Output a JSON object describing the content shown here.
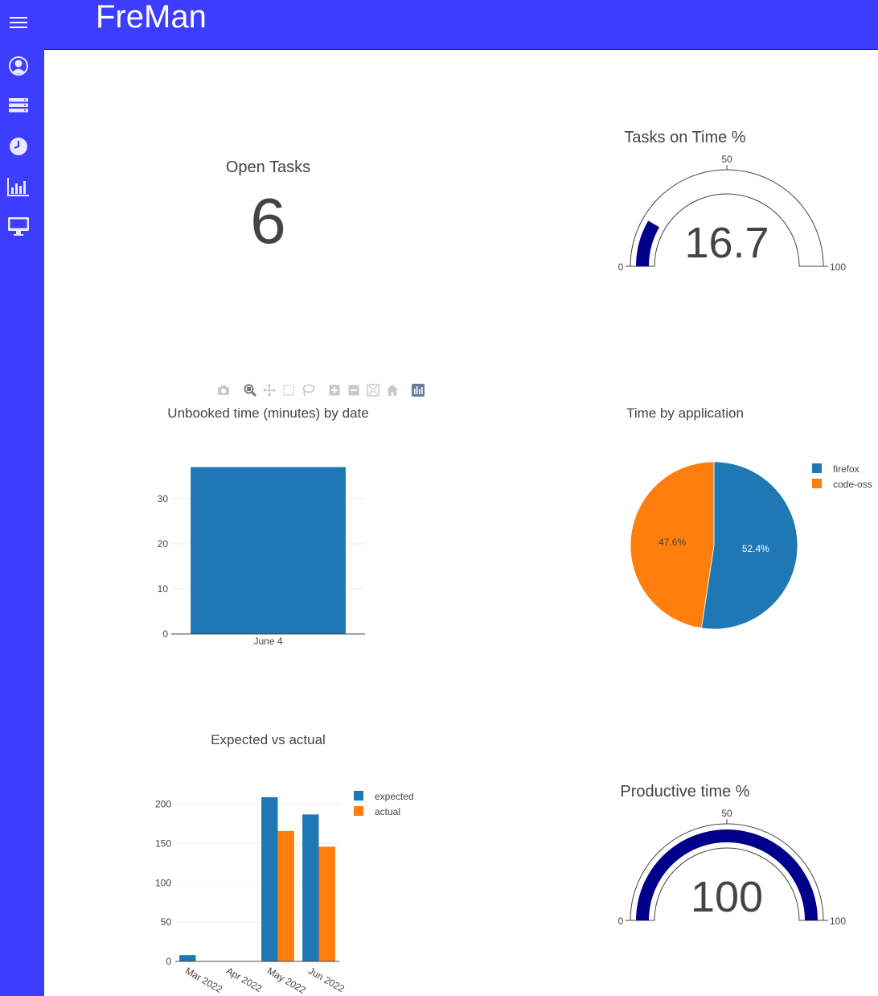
{
  "app": {
    "title": "FreMan"
  },
  "sidebar": {
    "items": [
      {
        "icon": "hamburger-menu-icon"
      },
      {
        "icon": "user-circle-icon"
      },
      {
        "icon": "server-icon"
      },
      {
        "icon": "clock-icon"
      },
      {
        "icon": "bar-chart-icon"
      },
      {
        "icon": "desktop-icon"
      }
    ]
  },
  "colors": {
    "sidebar": "#3d3dff",
    "blue": "#1f77b4",
    "orange": "#ff7f0e",
    "gauge": "#00008b",
    "text": "#444444"
  },
  "open_tasks": {
    "title": "Open Tasks",
    "value": "6"
  },
  "tasks_on_time": {
    "title": "Tasks on Time %",
    "value": "16.7",
    "min_label": "0",
    "mid_label": "50",
    "max_label": "100"
  },
  "productive_time": {
    "title": "Productive time %",
    "value": "100",
    "min_label": "0",
    "mid_label": "50",
    "max_label": "100"
  },
  "modebar": {
    "buttons": [
      "camera-icon",
      "zoom-icon",
      "pan-icon",
      "box-select-icon",
      "lasso-select-icon",
      "zoom-in-icon",
      "zoom-out-icon",
      "autoscale-icon",
      "reset-axes-icon",
      "plotly-logo-icon"
    ]
  },
  "chart_data": [
    {
      "type": "gauge",
      "title": "Tasks on Time %",
      "value": 16.7,
      "range": [
        0,
        100
      ],
      "ticks": [
        "0",
        "50",
        "100"
      ]
    },
    {
      "type": "bar",
      "title": "Unbooked time (minutes) by date",
      "categories": [
        "June 4"
      ],
      "values": [
        37
      ],
      "ylim": [
        0,
        38
      ],
      "yticks": [
        0,
        10,
        20,
        30
      ],
      "grid": true
    },
    {
      "type": "pie",
      "title": "Time by application",
      "labels": [
        "firefox",
        "code-oss"
      ],
      "values": [
        52.4,
        47.6
      ],
      "text": [
        "52.4%",
        "47.6%"
      ],
      "legend": "top-right"
    },
    {
      "type": "bar",
      "title": "Expected vs actual",
      "categories": [
        "Mar 2022",
        "Apr 2022",
        "May 2022",
        "Jun 2022"
      ],
      "series": [
        {
          "name": "expected",
          "values": [
            8,
            0,
            209,
            187
          ]
        },
        {
          "name": "actual",
          "values": [
            0,
            0,
            166,
            146
          ]
        }
      ],
      "ylim": [
        0,
        215
      ],
      "yticks": [
        0,
        50,
        100,
        150,
        200
      ],
      "legend": "top-right",
      "grid": true
    },
    {
      "type": "gauge",
      "title": "Productive time %",
      "value": 100,
      "range": [
        0,
        100
      ],
      "ticks": [
        "0",
        "50",
        "100"
      ]
    }
  ]
}
